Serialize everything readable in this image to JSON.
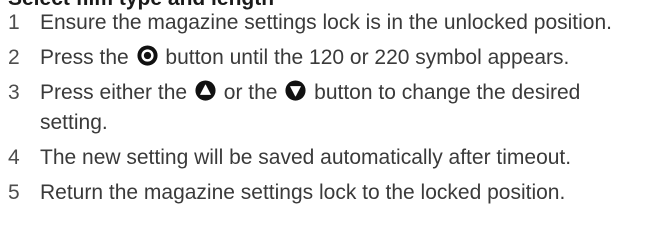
{
  "heading": "Select film type and length",
  "steps": [
    {
      "number": "1",
      "text": "Ensure the magazine settings lock is in the unlocked position."
    },
    {
      "number": "2",
      "text_before": "Press the",
      "icon": "select-circle-button-icon",
      "text_after": "button until the 120 or 220 symbol appears."
    },
    {
      "number": "3",
      "text_before": "Press either the",
      "icon_1": "up-arrow-button-icon",
      "text_middle": "or the",
      "icon_2": "down-arrow-button-icon",
      "text_after": "button to change the desired setting."
    },
    {
      "number": "4",
      "text": "The new setting will be saved automatically after timeout."
    },
    {
      "number": "5",
      "text": "Return the magazine settings lock to the locked position."
    }
  ]
}
